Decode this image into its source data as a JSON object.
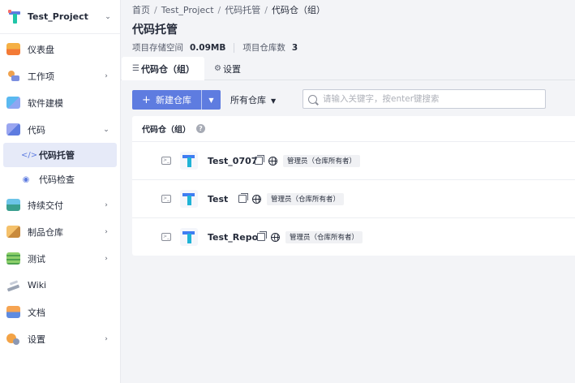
{
  "sidebar": {
    "project_name": "Test_Project",
    "items": [
      {
        "label": "仪表盘",
        "icon": "dashboard-icon",
        "has_children": false
      },
      {
        "label": "工作项",
        "icon": "work-item-icon",
        "has_children": true
      },
      {
        "label": "软件建模",
        "icon": "modeling-icon",
        "has_children": false
      },
      {
        "label": "代码",
        "icon": "code-icon",
        "has_children": true,
        "expanded": true,
        "children": [
          {
            "label": "代码托管",
            "icon": "code-hosting-icon",
            "active": true
          },
          {
            "label": "代码检查",
            "icon": "code-check-icon",
            "active": false
          }
        ]
      },
      {
        "label": "持续交付",
        "icon": "delivery-icon",
        "has_children": true
      },
      {
        "label": "制品仓库",
        "icon": "artifact-icon",
        "has_children": true
      },
      {
        "label": "测试",
        "icon": "test-icon",
        "has_children": true
      },
      {
        "label": "Wiki",
        "icon": "wiki-icon",
        "has_children": false
      },
      {
        "label": "文档",
        "icon": "document-icon",
        "has_children": false
      },
      {
        "label": "设置",
        "icon": "settings-icon",
        "has_children": true
      }
    ]
  },
  "breadcrumb": [
    "首页",
    "Test_Project",
    "代码托管",
    "代码仓（组）"
  ],
  "page": {
    "title": "代码托管",
    "storage_label": "项目存储空间",
    "storage_value": "0.09MB",
    "repo_count_label": "项目仓库数",
    "repo_count_value": "3"
  },
  "tabs": [
    {
      "label": "代码仓（组）",
      "icon": "list-icon",
      "active": true
    },
    {
      "label": "设置",
      "icon": "gear-icon",
      "active": false
    }
  ],
  "toolbar": {
    "new_repo_label": "新建仓库",
    "filter_label": "所有仓库",
    "search_placeholder": "请输入关键字，按enter键搜索"
  },
  "panel": {
    "header": "代码仓（组）",
    "help_glyph": "?",
    "terminal_glyph": ">_",
    "rows": [
      {
        "name": "Test_0707",
        "role": "管理员（仓库所有者）"
      },
      {
        "name": "Test",
        "role": "管理员（仓库所有者）"
      },
      {
        "name": "Test_Repo",
        "role": "管理员（仓库所有者）"
      }
    ]
  },
  "colors": {
    "accent": "#5e7ce0",
    "active_bg": "#e6eaf8"
  }
}
